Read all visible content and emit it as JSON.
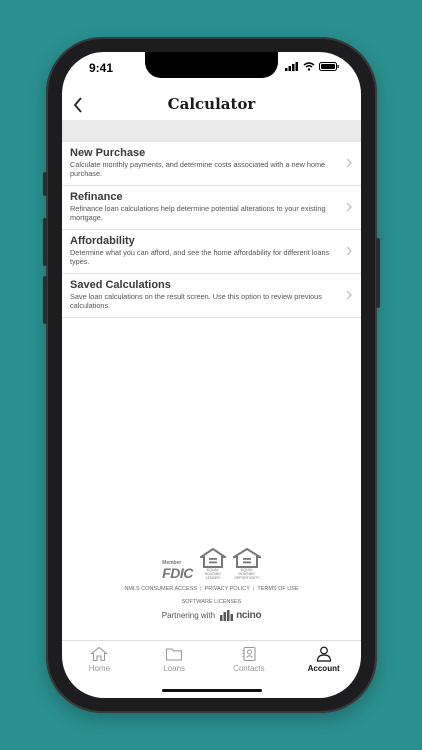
{
  "status_bar": {
    "time": "9:41"
  },
  "header": {
    "title": "Calculator"
  },
  "items": [
    {
      "title": "New Purchase",
      "description": "Calculate monthly payments, and determine costs associated with a new home purchase."
    },
    {
      "title": "Refinance",
      "description": "Refinance loan calculations help determine potential alterations to your existing mortgage."
    },
    {
      "title": "Affordability",
      "description": "Determine what you can afford, and see the home affordability for different loans types."
    },
    {
      "title": "Saved Calculations",
      "description": "Save loan calculations on the result screen. Use this option to review previous calculations."
    }
  ],
  "footer": {
    "fdic_member": "Member",
    "fdic_word": "FDIC",
    "ehl_lender": "EQUAL HOUSING LENDER",
    "ehl_opportunity": "EQUAL HOUSING OPPORTUNITY",
    "links": [
      "NMLS CONSUMER ACCESS",
      "PRIVACY POLICY",
      "TERMS OF USE"
    ],
    "software_licenses": "SOFTWARE LICENSES",
    "partnering_label": "Partnering with",
    "partner_name": "ncino"
  },
  "tabs": [
    {
      "label": "Home",
      "icon": "home-icon",
      "active": false
    },
    {
      "label": "Loans",
      "icon": "folder-icon",
      "active": false
    },
    {
      "label": "Contacts",
      "icon": "contact-book-icon",
      "active": false
    },
    {
      "label": "Account",
      "icon": "person-icon",
      "active": true
    }
  ],
  "colors": {
    "background": "#2a9190",
    "accent_text": "#111111",
    "inactive_tab": "#999999"
  }
}
